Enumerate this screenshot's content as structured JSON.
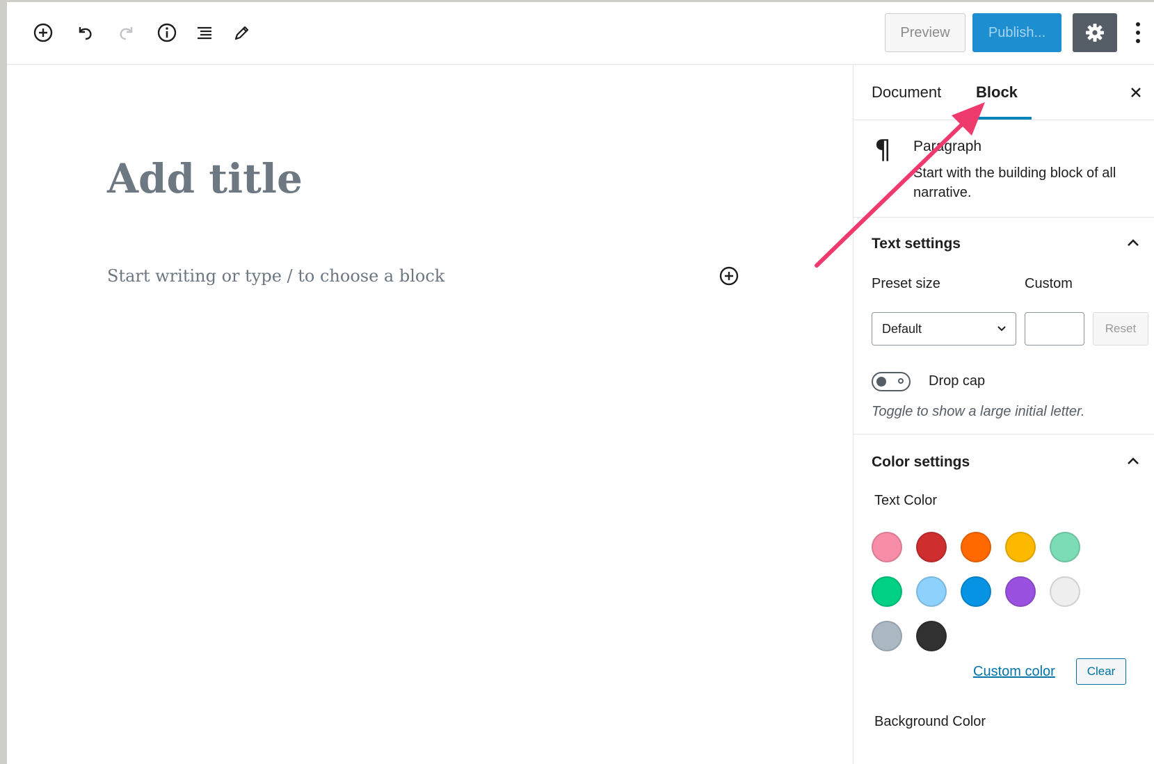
{
  "toolbar": {
    "preview_label": "Preview",
    "publish_label": "Publish...",
    "icons": [
      "add-block-icon",
      "undo-icon",
      "redo-icon",
      "info-icon",
      "list-view-icon",
      "pencil-icon"
    ]
  },
  "editor": {
    "title_placeholder": "Add title",
    "paragraph_placeholder": "Start writing or type / to choose a block"
  },
  "sidebar": {
    "tabs": [
      {
        "label": "Document",
        "active": false
      },
      {
        "label": "Block",
        "active": true
      }
    ],
    "block": {
      "name": "Paragraph",
      "description": "Start with the building block of all narrative."
    },
    "text_settings": {
      "title": "Text settings",
      "preset_label": "Preset size",
      "custom_label": "Custom",
      "preset_value": "Default",
      "reset_label": "Reset",
      "drop_cap_label": "Drop cap",
      "drop_cap_help": "Toggle to show a large initial letter."
    },
    "color_settings": {
      "title": "Color settings",
      "text_color_label": "Text Color",
      "swatches": [
        "#f78da7",
        "#cf2e2e",
        "#ff6900",
        "#fcb900",
        "#7bdcb5",
        "#00d084",
        "#8ed1fc",
        "#0693e3",
        "#9b51e0",
        "#eeeeee",
        "#abb8c3",
        "#313131"
      ],
      "custom_color_label": "Custom color",
      "clear_label": "Clear",
      "background_color_label": "Background Color"
    }
  },
  "colors": {
    "accent": "#0085ba",
    "publish_bg": "#1d8fd0",
    "settings_bg": "#555d66",
    "annotation_arrow": "#ef3a6e"
  }
}
